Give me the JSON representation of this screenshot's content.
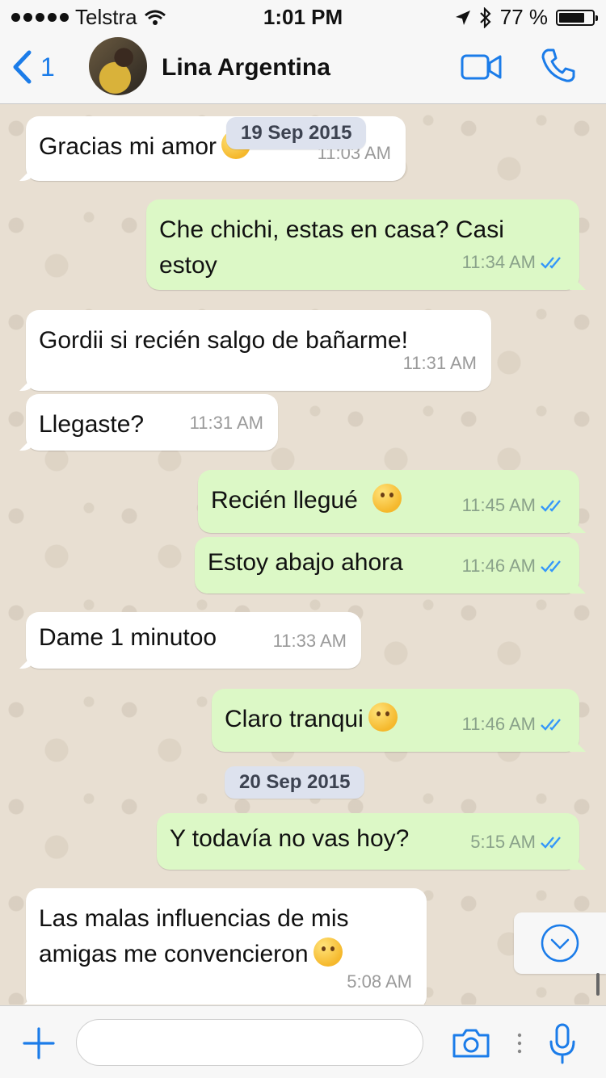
{
  "status": {
    "carrier": "Telstra",
    "time": "1:01 PM",
    "battery_percent": "77 %",
    "battery_level": 0.77
  },
  "header": {
    "back_count": "1",
    "contact_name": "Lina Argentina",
    "icons": [
      "back-chevron-icon",
      "video-call-icon",
      "phone-icon"
    ]
  },
  "messages": [
    {
      "dir": "in",
      "text": "Gracias mi amor",
      "time": "11:03 AM"
    },
    {
      "dir": "out",
      "text": "Che chichi, estas en casa? Casi estoy",
      "time": "11:34 AM"
    },
    {
      "dir": "in",
      "text": "Gordii si recién salgo de bañarme!",
      "time": "11:31 AM"
    },
    {
      "dir": "in",
      "text": "Llegaste?",
      "time": "11:31 AM"
    },
    {
      "dir": "out",
      "text": "Recién llegué",
      "time": "11:45 AM"
    },
    {
      "dir": "out",
      "text": "Estoy abajo ahora",
      "time": "11:46 AM"
    },
    {
      "dir": "in",
      "text": "Dame 1 minutoo",
      "time": "11:33 AM"
    },
    {
      "dir": "out",
      "text": "Claro tranqui",
      "time": "11:46 AM"
    },
    {
      "dir": "out",
      "text": "Y todavía no vas hoy?",
      "time": "5:15 AM"
    },
    {
      "dir": "in",
      "text": "Las malas influencias de mis amigas me convencieron",
      "time": "5:08 AM"
    }
  ],
  "dates": [
    "19 Sep 2015",
    "20 Sep 2015"
  ],
  "input": {
    "placeholder": "",
    "icons": [
      "plus-icon",
      "camera-icon",
      "microphone-icon"
    ]
  },
  "colors": {
    "accent": "#1b7ce9",
    "outgoing_bubble": "#dcf8c6",
    "incoming_bubble": "#ffffff",
    "read_ticks": "#3497f9",
    "chat_background": "#e8dfd2"
  }
}
